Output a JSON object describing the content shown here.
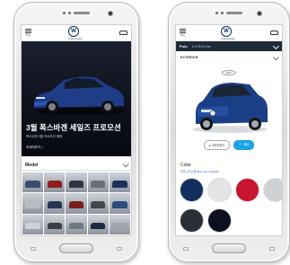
{
  "left_screen": {
    "header": {
      "menu_label": "메뉴",
      "brand_tag": "Volkswagen"
    },
    "hero": {
      "title": "3월 폭스바겐 세일즈 프로모션",
      "subtitle": "폭스바겐 3월 프로모션 혜택",
      "link": "자세히보기 >"
    },
    "model_section": {
      "label": "Model"
    },
    "thumb_colors": [
      "#3b4a6e",
      "#8d1c1c",
      "#2e3540",
      "#6a6f77",
      "#1d2f5a",
      "#b8bcc2",
      "#23344f",
      "#7a1e1e",
      "#44494f",
      "#2a4d7a",
      "#cfd2d6",
      "#3a3f46",
      "#6e7680",
      "#1e2a44",
      "#9ea4ab"
    ]
  },
  "right_screen": {
    "header": {
      "menu_label": "메뉴",
      "brand_tag": "Volkswagen"
    },
    "model_header": {
      "model": "Polo",
      "trim": "1.4 TDI R-Line"
    },
    "exterior_label": "EXTERIOR",
    "rotation_hint": "360°",
    "buttons": {
      "gallery": "● 이미지보기",
      "compare": "🔍 확대"
    },
    "color_section": {
      "label": "Color",
      "selected": "블루 오닉스펄 Blue Onyx Metallic",
      "swatches": [
        "#11305e",
        "#e2e4e6",
        "#c8142c",
        "#cfd2d4",
        "#2a2f36",
        "#0d1020"
      ]
    },
    "accent": "#18a3e6"
  }
}
